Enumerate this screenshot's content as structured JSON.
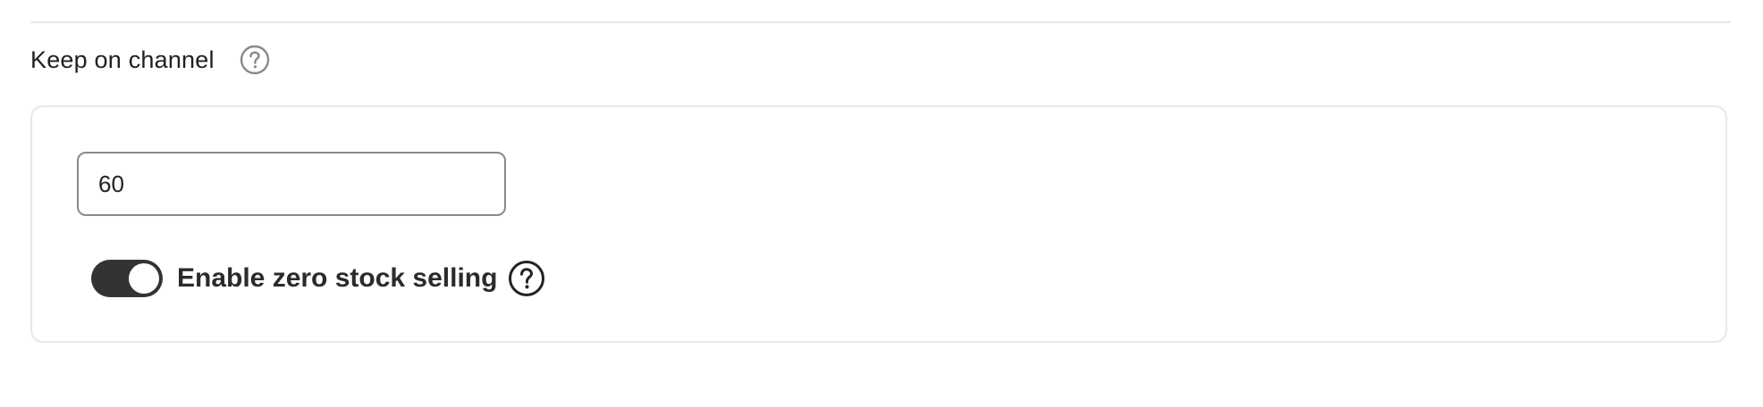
{
  "section": {
    "title": "Keep on channel",
    "help_icon": "question-circle-icon"
  },
  "input": {
    "value": "60"
  },
  "zero_stock": {
    "label": "Enable zero stock selling",
    "enabled": true,
    "help_icon": "question-circle-icon"
  },
  "colors": {
    "toggle_on": "#333333",
    "border": "#e6e8ec",
    "input_border": "#8a8a8a",
    "muted_icon": "#8a8a8a"
  }
}
